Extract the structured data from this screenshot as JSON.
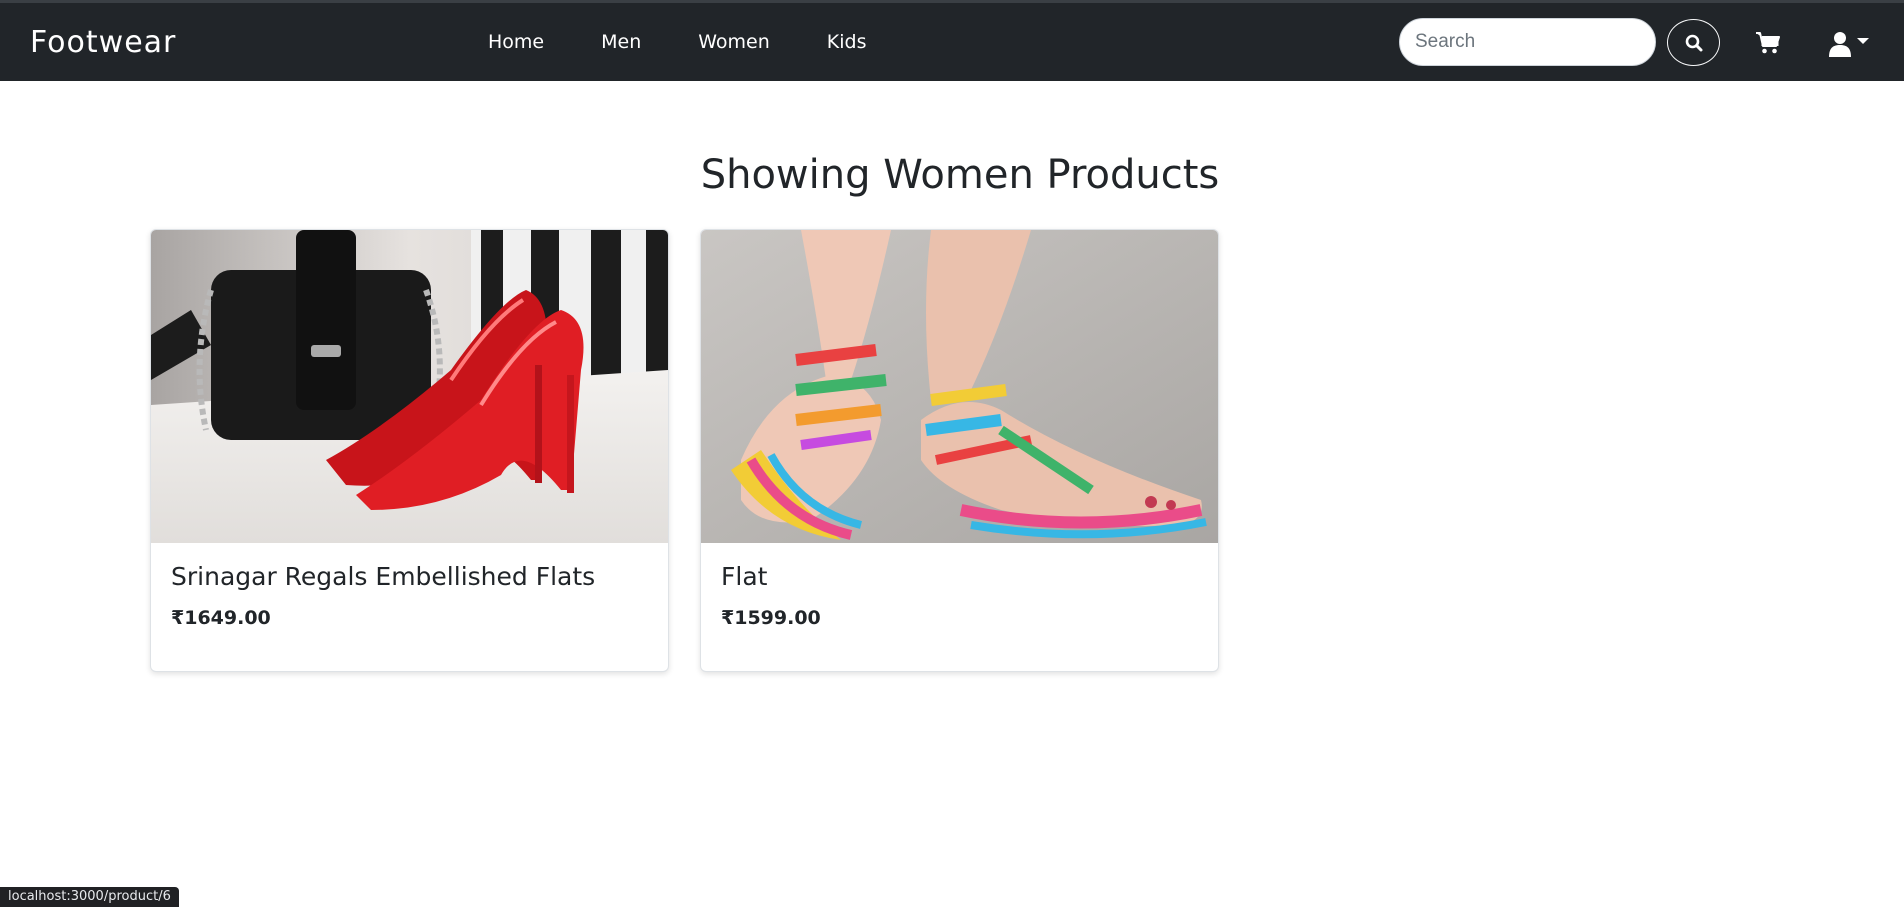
{
  "navbar": {
    "brand": "Footwear",
    "links": [
      {
        "label": "Home"
      },
      {
        "label": "Men"
      },
      {
        "label": "Women"
      },
      {
        "label": "Kids"
      }
    ],
    "search": {
      "placeholder": "Search",
      "value": ""
    },
    "icons": {
      "search": "search-icon",
      "cart": "cart-icon",
      "user": "user-icon",
      "dropdown": "caret-down-icon"
    }
  },
  "main": {
    "heading": "Showing Women Products",
    "products": [
      {
        "name": "Srinagar Regals Embellished Flats",
        "price": "₹1649.00"
      },
      {
        "name": "Flat",
        "price": "₹1599.00"
      }
    ]
  },
  "status_bar": {
    "url": "localhost:3000/product/6"
  },
  "colors": {
    "navbar_bg": "#212529",
    "text": "#212529",
    "white": "#ffffff"
  }
}
